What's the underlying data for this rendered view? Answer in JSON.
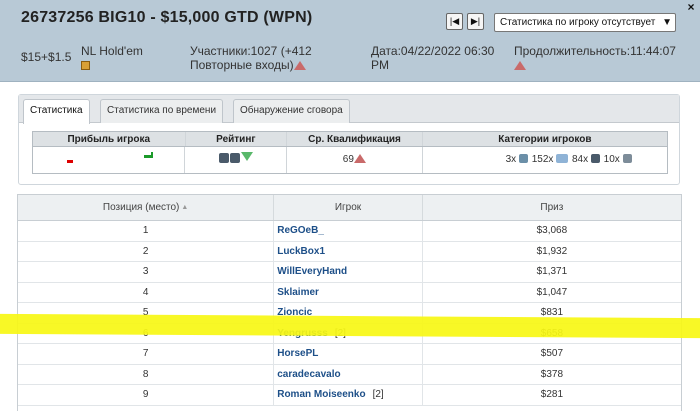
{
  "header": {
    "title": "26737256 BIG10 - $15,000 GTD (WPN)",
    "close_glyph": "×",
    "nav_first_glyph": "|◀",
    "nav_last_glyph": "▶|",
    "player_select_value": "Статистика по игроку отсутствует",
    "buyin": "$15+$1.5",
    "game": "NL Hold'em",
    "entrants": "Участники:1027 (+412 Повторные входы)",
    "date": "Дата:04/22/2022 06:30 PM",
    "duration": "Продолжительность:11:44:07"
  },
  "tabs": [
    {
      "label": "Статистика",
      "active": true
    },
    {
      "label": "Статистика по времени",
      "active": false
    },
    {
      "label": "Обнаружение сговора",
      "active": false
    }
  ],
  "categories": {
    "headers": [
      "Прибыль игрока",
      "Рейтинг",
      "Ср. Квалификация",
      "Категории игроков"
    ],
    "avg_qualification": "69",
    "player_categories": [
      {
        "count": "3x",
        "icon": "player-type-icon-1"
      },
      {
        "count": "152x",
        "icon": "player-type-icon-2"
      },
      {
        "count": "84x",
        "icon": "player-type-icon-3"
      },
      {
        "count": "10x",
        "icon": "player-type-icon-4"
      }
    ],
    "colors": {
      "loss": "#dd0000",
      "gain": "#1b9a2a",
      "down": "#59b86a",
      "up": "#c96a6a"
    }
  },
  "results": {
    "headers": {
      "position": "Позиция (место)",
      "player": "Игрок",
      "prize": "Приз"
    },
    "rows": [
      {
        "pos": "1",
        "player": "ReGOeB_",
        "extra": "",
        "prize": "$3,068"
      },
      {
        "pos": "2",
        "player": "LuckBox1",
        "extra": "",
        "prize": "$1,932"
      },
      {
        "pos": "3",
        "player": "WillEveryHand",
        "extra": "",
        "prize": "$1,371"
      },
      {
        "pos": "4",
        "player": "Sklaimer",
        "extra": "",
        "prize": "$1,047"
      },
      {
        "pos": "5",
        "player": "Zioncic",
        "extra": "",
        "prize": "$831"
      },
      {
        "pos": "6",
        "player": "Yengrusss",
        "extra": "[2]",
        "prize": "$658"
      },
      {
        "pos": "7",
        "player": "HorsePL",
        "extra": "",
        "prize": "$507"
      },
      {
        "pos": "8",
        "player": "caradecavalo",
        "extra": "",
        "prize": "$378"
      },
      {
        "pos": "9",
        "player": "Roman Moiseenko",
        "extra": "[2]",
        "prize": "$281"
      }
    ],
    "highlight_color": "#f7f714"
  }
}
